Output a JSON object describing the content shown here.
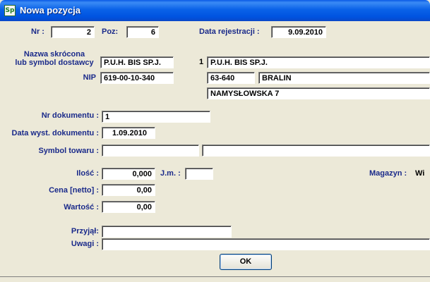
{
  "window": {
    "title": "Nowa pozycja",
    "icon": "Sp"
  },
  "labels": {
    "nr": "Nr :",
    "poz": "Poz:",
    "data_rejestracji": "Data rejestracji :",
    "nazwa_line1": "Nazwa skrócona",
    "nazwa_line2": "lub symbol dostawcy",
    "nip": "NIP",
    "nr_dokumentu": "Nr dokumentu :",
    "data_wyst": "Data wyst. dokumentu :",
    "symbol_towaru": "Symbol towaru :",
    "ilosc": "Ilość :",
    "jm": "J.m. :",
    "magazyn": "Magazyn :",
    "cena": "Cena [netto] :",
    "wartosc": "Wartość :",
    "przyjal": "Przyjął:",
    "uwagi": "Uwagi :"
  },
  "values": {
    "nr": "2",
    "poz": "6",
    "data_rejestracji": "9.09.2010",
    "nazwa_skrocona": "P.U.H. BIS SP.J.",
    "supplier_index": "1",
    "supplier_name": "P.U.H. BIS SP.J.",
    "nip": "619-00-10-340",
    "postal_code": "63-640",
    "city": "BRALIN",
    "street": "NAMYSŁOWSKA 7",
    "nr_dokumentu": "1",
    "data_wyst": "1.09.2010",
    "symbol_towaru": "",
    "towar_nazwa": "",
    "ilosc": "0,000",
    "jm": "",
    "magazyn": "Wi",
    "cena": "0,00",
    "wartosc": "0,00",
    "przyjal": "",
    "uwagi": ""
  },
  "buttons": {
    "ok": "OK"
  }
}
